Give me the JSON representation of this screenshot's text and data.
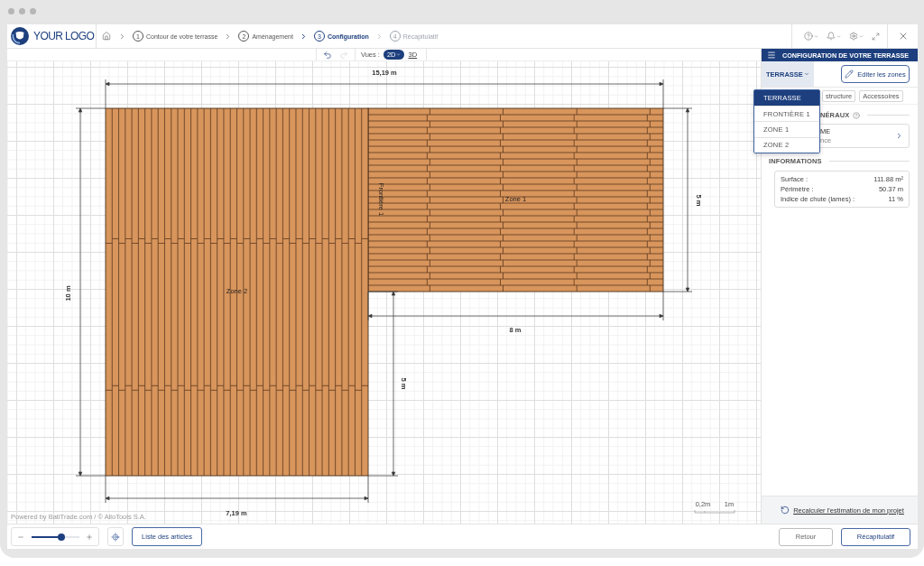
{
  "header": {
    "logo": "YOUR LOGO",
    "steps": [
      {
        "number": "1",
        "label": "Contour de votre terrasse",
        "selected": false,
        "disabled": false
      },
      {
        "number": "2",
        "label": "Aménagement",
        "selected": false,
        "disabled": false
      },
      {
        "number": "3",
        "label": "Configuration",
        "selected": true,
        "disabled": false
      },
      {
        "number": "4",
        "label": "Récapitulatif",
        "selected": false,
        "disabled": true
      }
    ]
  },
  "toolbar": {
    "undo": {
      "disabled": false
    },
    "redo": {
      "disabled": true
    },
    "views_label": "Vues :",
    "views": [
      {
        "label": "2D",
        "selected": true
      },
      {
        "label": "3D",
        "selected": false
      }
    ]
  },
  "canvas": {
    "zones": [
      {
        "label": "Zone 1",
        "kind": "horizontal"
      },
      {
        "label": "Zone 2",
        "kind": "vertical"
      }
    ],
    "boundary_label": "Frontière 1",
    "dimensions": {
      "top": "15,19 m",
      "right": "5 m",
      "left": "10 m",
      "inner_bottom": "8 m",
      "inner_side": "5 m",
      "bottom": "7,19 m"
    },
    "scale": [
      "0,2m",
      "1m"
    ],
    "credit": "Powered by BatiTrade.com / © AlloTools S.A."
  },
  "panel": {
    "title": "CONFIGURATION DE VOTRE TERRASSE",
    "zone_select": {
      "value": "TERRASSE",
      "expanded": true,
      "options": [
        {
          "label": "TERRASSE",
          "selected": true
        },
        {
          "label": "FRONTIÈRE 1",
          "selected": false
        },
        {
          "label": "ZONE 1",
          "selected": false
        },
        {
          "label": "ZONE 2",
          "selected": false
        }
      ]
    },
    "edit_button": "Editer les zones",
    "chips": [
      "structure",
      "Accessoires"
    ],
    "section": {
      "title": "NÉRAUX"
    },
    "section_card": {
      "title": "ME",
      "subtitle": "nce"
    },
    "informations": {
      "title": "INFORMATIONS",
      "rows": [
        {
          "label": "Surface :",
          "value": "111.88 m²"
        },
        {
          "label": "Périmètre :",
          "value": "50.37 m"
        },
        {
          "label": "Indice de chute (lames) :",
          "value": "11 %"
        }
      ]
    },
    "recalc_link": "Recalculer l'estimation de mon projet"
  },
  "bottom_bar": {
    "zoom": {
      "level": 0.64
    },
    "articles_button": "Liste des articles",
    "back_button": "Retour",
    "next_button": "Récapitulatif"
  }
}
